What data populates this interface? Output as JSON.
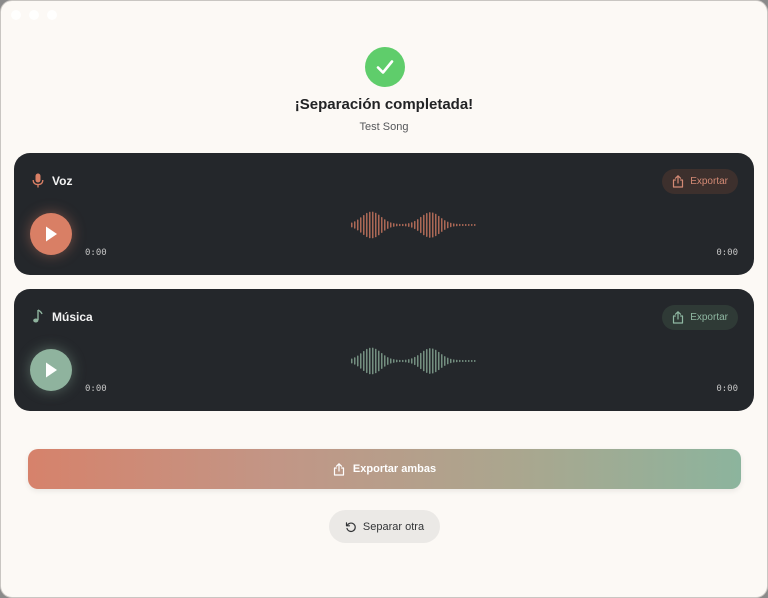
{
  "header": {
    "title": "¡Separación completada!",
    "song_name": "Test Song"
  },
  "tracks": [
    {
      "label": "Voz",
      "icon": "microphone-icon",
      "export_label": "Exportar",
      "current_time": "0:00",
      "duration": "0:00",
      "color": "#d97f65"
    },
    {
      "label": "Música",
      "icon": "music-note-icon",
      "export_label": "Exportar",
      "current_time": "0:00",
      "duration": "0:00",
      "color": "#8fb39e"
    }
  ],
  "actions": {
    "export_all_label": "Exportar ambas",
    "separate_another_label": "Separar otra"
  },
  "colors": {
    "success": "#5fcd6b",
    "card_bg": "#24272b",
    "voice_accent": "#d97f65",
    "music_accent": "#8fb39e",
    "page_bg": "#fcf9f5"
  }
}
